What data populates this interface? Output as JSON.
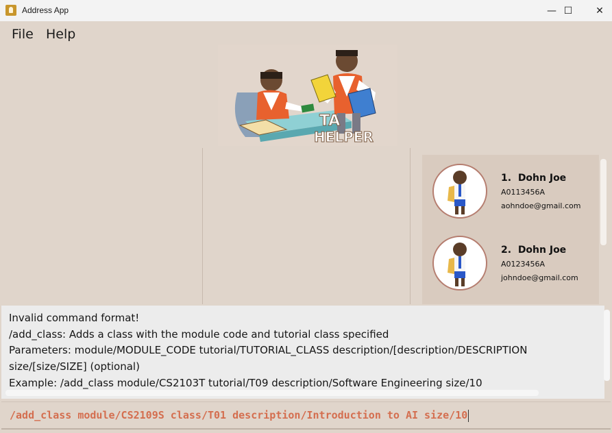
{
  "window": {
    "title": "Address App",
    "minimize_glyph": "—",
    "maximize_glyph": "☐",
    "close_glyph": "✕"
  },
  "menu": [
    {
      "label": "File"
    },
    {
      "label": "Help"
    }
  ],
  "logo": {
    "text_line1": "TA",
    "text_line2": "HELPER",
    "icon": "ta-helper-logo"
  },
  "persons": [
    {
      "index": "1.",
      "name": "Dohn Joe",
      "id": "A0113456A",
      "email": "aohndoe@gmail.com"
    },
    {
      "index": "2.",
      "name": "Dohn Joe",
      "id": "A0123456A",
      "email": "johndoe@gmail.com"
    }
  ],
  "result_display": {
    "lines": [
      "Invalid command format!",
      "/add_class: Adds a class with the module code and tutorial class specified",
      "Parameters: module/MODULE_CODE tutorial/TUTORIAL_CLASS description/[description/DESCRIPTION",
      "size/[size/SIZE] (optional)",
      "Example: /add_class module/CS2103T tutorial/T09 description/Software Engineering size/10"
    ]
  },
  "command_box": {
    "value": "/add_class module/CS2109S class/T01 description/Introduction to AI size/10"
  },
  "colors": {
    "background": "#e0d5cb",
    "list_background": "#d9cbbf",
    "command_text": "#d46e4f",
    "result_background": "#ececec"
  }
}
